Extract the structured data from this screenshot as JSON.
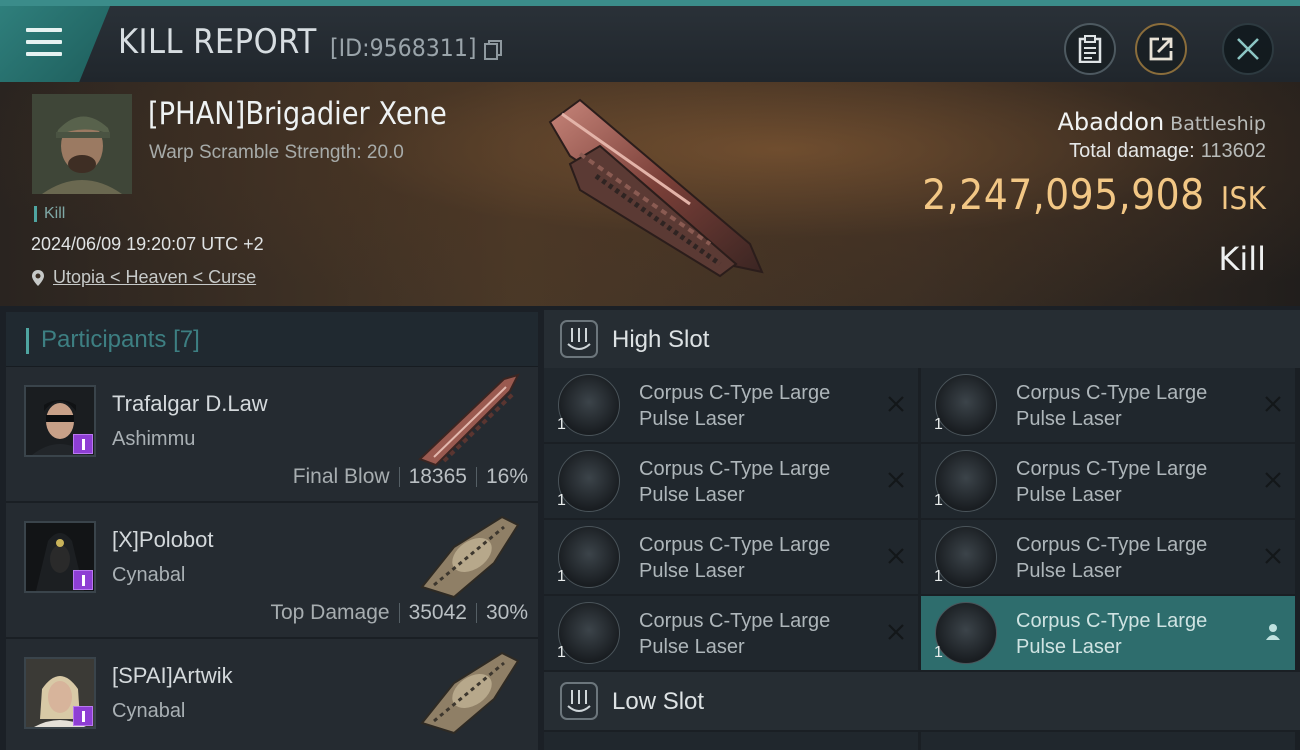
{
  "header": {
    "title": "KILL REPORT",
    "report_id": "[ID:9568311]"
  },
  "victim": {
    "name": "[PHAN]Brigadier Xene",
    "warp_scramble": "Warp Scramble Strength: 20.0",
    "tag": "Kill",
    "timestamp": "2024/06/09 19:20:07 UTC +2",
    "location": "Utopia < Heaven < Curse",
    "ship_name": "Abaddon",
    "ship_class": "Battleship",
    "total_damage_label": "Total damage:",
    "total_damage": "113602",
    "isk_value": "2,247,095,908",
    "isk_unit": "ISK",
    "kill_type": "Kill"
  },
  "participants": {
    "label": "Participants",
    "count": "[7]",
    "rows": [
      {
        "name": "Trafalgar D.Law",
        "ship": "Ashimmu",
        "role": "Final Blow",
        "damage": "18365",
        "percent": "16%"
      },
      {
        "name": "[X]Polobot",
        "ship": "Cynabal",
        "role": "Top Damage",
        "damage": "35042",
        "percent": "30%"
      },
      {
        "name": "[SPAI]Artwik",
        "ship": "Cynabal"
      }
    ]
  },
  "slots": {
    "high_label": "High Slot",
    "low_label": "Low Slot",
    "modules": [
      {
        "line1": "Corpus C-Type Large",
        "line2": "Pulse Laser",
        "qty": "1"
      },
      {
        "line1": "Corpus C-Type Large",
        "line2": "Pulse Laser",
        "qty": "1"
      },
      {
        "line1": "Corpus C-Type Large",
        "line2": "Pulse Laser",
        "qty": "1"
      },
      {
        "line1": "Corpus C-Type Large",
        "line2": "Pulse Laser",
        "qty": "1"
      },
      {
        "line1": "Corpus C-Type Large",
        "line2": "Pulse Laser",
        "qty": "1"
      },
      {
        "line1": "Corpus C-Type Large",
        "line2": "Pulse Laser",
        "qty": "1"
      },
      {
        "line1": "Corpus C-Type Large",
        "line2": "Pulse Laser",
        "qty": "1"
      },
      {
        "line1": "Corpus C-Type Large",
        "line2": "Pulse Laser",
        "qty": "1"
      }
    ]
  },
  "colors": {
    "accent": "#3b8c8a",
    "isk": "#f2c785",
    "badge": "#8e3ed4",
    "active_module": "#2e6d6d"
  },
  "icons": [
    "menu-icon",
    "copy-icon",
    "clipboard-icon",
    "share-icon",
    "close-icon",
    "location-pin-icon",
    "slot-icon",
    "module-icon",
    "remove-x-icon",
    "pilot-icon"
  ]
}
